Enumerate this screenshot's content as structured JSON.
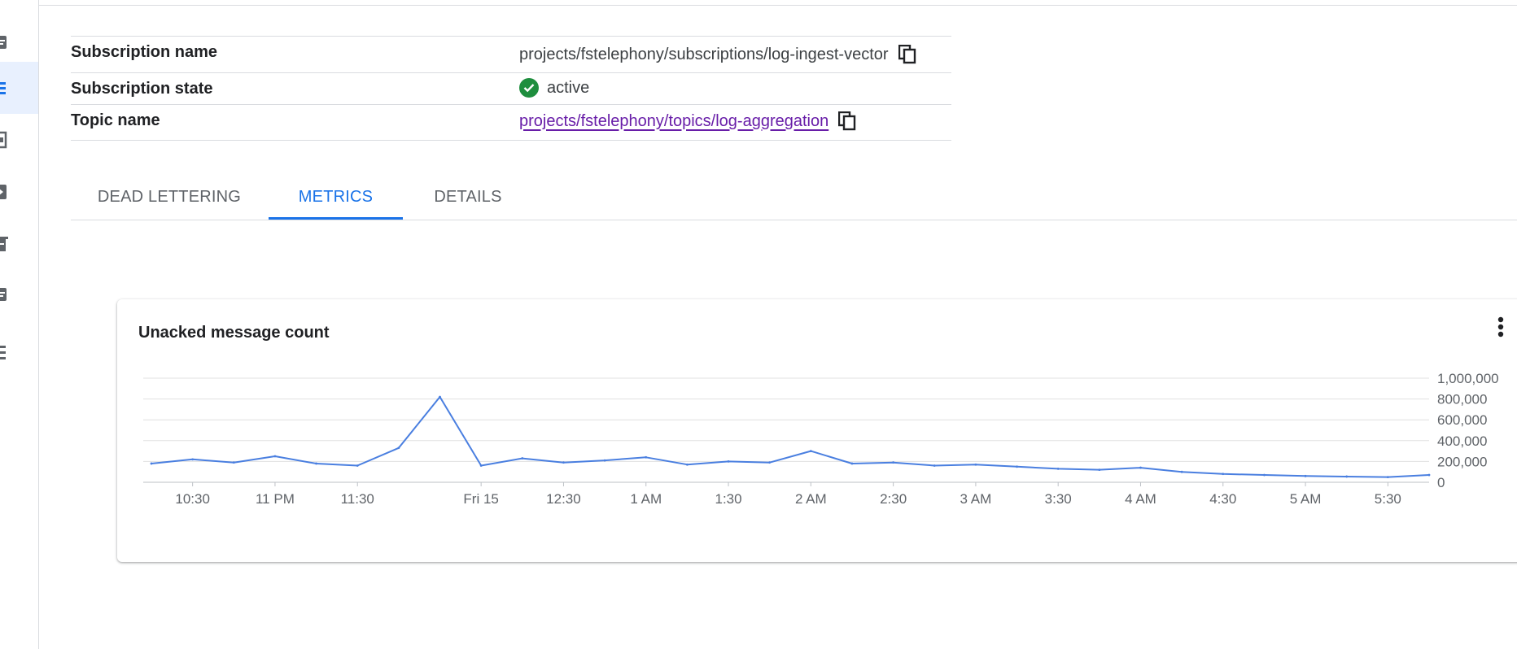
{
  "nav": {
    "icons": [
      "overview-icon",
      "subscriptions-icon",
      "snapshots-icon",
      "schema-icon",
      "topics-icon",
      "messages-icon",
      "list-icon"
    ],
    "active_index": 1
  },
  "details": {
    "subscription_name_label": "Subscription name",
    "subscription_name_value": "projects/fstelephony/subscriptions/log-ingest-vector",
    "subscription_state_label": "Subscription state",
    "subscription_state_value": "active",
    "topic_name_label": "Topic name",
    "topic_name_value": "projects/fstelephony/topics/log-aggregation"
  },
  "tabs": [
    {
      "label": "DEAD LETTERING",
      "active": false
    },
    {
      "label": "METRICS",
      "active": true
    },
    {
      "label": "DETAILS",
      "active": false
    }
  ],
  "colors": {
    "accent": "#1a73e8",
    "status_active": "#1e8e3e",
    "link": "#681da8",
    "series": "#4a7fe0"
  },
  "chart_data": {
    "type": "line",
    "title": "Unacked message count",
    "x": [
      "10:18",
      "10:30",
      "10:45",
      "11 PM",
      "11:15",
      "11:30",
      "11:45",
      "11:48",
      "Fri 15",
      "12:15",
      "12:30",
      "12:45",
      "1 AM",
      "1:15",
      "1:30",
      "1:45",
      "2 AM",
      "2:15",
      "2:30",
      "2:45",
      "3 AM",
      "3:15",
      "3:30",
      "3:45",
      "4 AM",
      "4:15",
      "4:30",
      "4:45",
      "5 AM",
      "5:15",
      "5:30",
      "5:35"
    ],
    "values": [
      180000,
      220000,
      190000,
      250000,
      180000,
      160000,
      330000,
      820000,
      160000,
      230000,
      190000,
      210000,
      240000,
      170000,
      200000,
      190000,
      300000,
      180000,
      190000,
      160000,
      170000,
      150000,
      130000,
      120000,
      140000,
      100000,
      80000,
      70000,
      60000,
      55000,
      50000,
      70000
    ],
    "x_tick_labels": [
      "10:30",
      "11 PM",
      "11:30",
      "Fri 15",
      "12:30",
      "1 AM",
      "1:30",
      "2 AM",
      "2:30",
      "3 AM",
      "3:30",
      "4 AM",
      "4:30",
      "5 AM",
      "5:30"
    ],
    "y_tick_labels": [
      "1,000,000",
      "800,000",
      "600,000",
      "400,000",
      "200,000",
      "0"
    ],
    "ylim": [
      0,
      1000000
    ],
    "grid": true,
    "legend": "none",
    "series_name": ""
  }
}
